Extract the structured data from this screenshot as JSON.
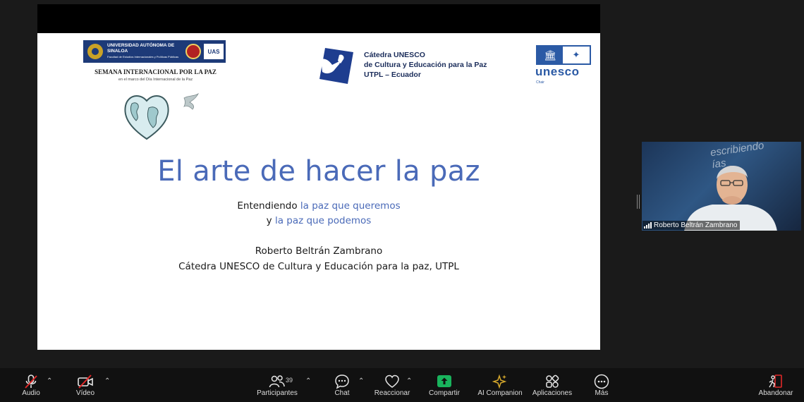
{
  "slide": {
    "uas_name": "UNIVERSIDAD AUTÓNOMA DE SINALOA",
    "uas_subtitle": "Facultad de Estudios Internacionales y Políticas Públicas",
    "uas_mark": "UAS",
    "week_title": "SEMANA INTERNACIONAL POR LA PAZ",
    "week_subtitle": "en el marco del Día Internacional de la Paz",
    "catedra_lines": [
      "Cátedra UNESCO",
      "de Cultura y Educación para la Paz",
      "UTPL – Ecuador"
    ],
    "unesco_word": "unesco",
    "unesco_chair": "Chair",
    "title": "El arte de hacer la paz",
    "sub1_a": "Entendiendo ",
    "sub1_b": "la paz que queremos",
    "sub2_a": "y ",
    "sub2_b": "la paz  que podemos",
    "author": "Roberto Beltrán Zambrano",
    "affiliation": "Cátedra UNESCO de Cultura y Educación para la paz, UTPL"
  },
  "video": {
    "participant_name": "Roberto Beltrán Zambrano",
    "background_text": "escribiendo\nías"
  },
  "toolbar": {
    "audio": "Audio",
    "video": "Vídeo",
    "participants": "Participantes",
    "participant_count": "39",
    "chat": "Chat",
    "react": "Reaccionar",
    "share": "Compartir",
    "companion": "AI Companion",
    "apps": "Aplicaciones",
    "more": "Más",
    "leave": "Abandonar"
  },
  "colors": {
    "accent_green": "#19b35c",
    "leave_red": "#e02828",
    "mute_red": "#e02828",
    "title_blue": "#4a6ab8",
    "companion_gold": "#d4a72c"
  }
}
